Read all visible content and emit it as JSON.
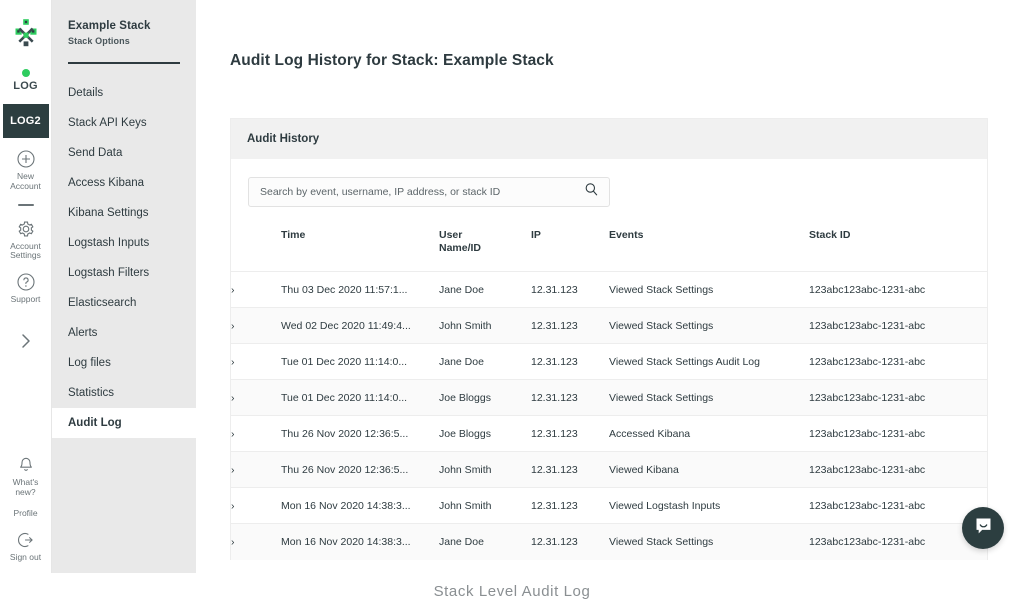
{
  "brand": {
    "logo_icon": "logit-nodes-logo",
    "green": "#2ecc5f",
    "dark": "#2c3e40"
  },
  "icon_rail": {
    "stacks": [
      {
        "label": "LOG",
        "status_dot": true,
        "active": false,
        "icon": "stack-status-dot-icon"
      },
      {
        "label": "LOG2",
        "status_dot": false,
        "active": true,
        "icon": "stack-tile-icon"
      }
    ],
    "items": [
      {
        "label": "New\nAccount",
        "line1": "New",
        "line2": "Account",
        "icon": "plus-circle-icon"
      },
      {
        "label": "Account\nSettings",
        "line1": "Account",
        "line2": "Settings",
        "icon": "gear-icon"
      },
      {
        "label": "Support",
        "line1": "Support",
        "line2": "",
        "icon": "question-circle-icon"
      }
    ],
    "expand": {
      "icon": "chevron-right-icon",
      "label": ""
    },
    "bottom_items": [
      {
        "label": "What's\nnew?",
        "line1": "What's",
        "line2": "new?",
        "icon": "bell-icon"
      },
      {
        "label": "Profile",
        "line1": "Profile",
        "line2": "",
        "icon": "avatar-icon"
      },
      {
        "label": "Sign out",
        "line1": "Sign out",
        "line2": "",
        "icon": "sign-out-icon"
      }
    ]
  },
  "options_panel": {
    "title": "Example Stack",
    "subtitle": "Stack Options",
    "nav": [
      {
        "label": "Details",
        "active": false
      },
      {
        "label": "Stack API Keys",
        "active": false
      },
      {
        "label": "Send Data",
        "active": false
      },
      {
        "label": "Access Kibana",
        "active": false
      },
      {
        "label": "Kibana Settings",
        "active": false
      },
      {
        "label": "Logstash Inputs",
        "active": false
      },
      {
        "label": "Logstash Filters",
        "active": false
      },
      {
        "label": "Elasticsearch",
        "active": false
      },
      {
        "label": "Alerts",
        "active": false
      },
      {
        "label": "Log files",
        "active": false
      },
      {
        "label": "Statistics",
        "active": false
      },
      {
        "label": "Audit Log",
        "active": true
      }
    ]
  },
  "page": {
    "title": "Audit Log History for Stack: Example Stack",
    "card_title": "Audit History"
  },
  "search": {
    "placeholder": "Search by event, username, IP address, or stack ID",
    "value": "",
    "icon": "search-icon"
  },
  "table": {
    "columns": [
      "Time",
      "User Name/ID",
      "IP",
      "Events",
      "Stack ID"
    ],
    "column_headers": {
      "toggle": "",
      "time": "Time",
      "user_line1": "User",
      "user_line2": "Name/ID",
      "ip": "IP",
      "events": "Events",
      "stack_id": "Stack ID"
    },
    "row_toggle_icon": "chevron-right-icon",
    "rows": [
      {
        "time": "Thu 03 Dec 2020 11:57:1...",
        "user": "Jane Doe",
        "ip": "12.31.123",
        "event": "Viewed Stack Settings",
        "stack_id": "123abc123abc-1231-abc"
      },
      {
        "time": "Wed 02 Dec 2020 11:49:4...",
        "user": "John Smith",
        "ip": "12.31.123",
        "event": "Viewed Stack Settings",
        "stack_id": "123abc123abc-1231-abc"
      },
      {
        "time": "Tue 01 Dec 2020 11:14:0...",
        "user": "Jane Doe",
        "ip": "12.31.123",
        "event": "Viewed Stack Settings Audit Log",
        "stack_id": "123abc123abc-1231-abc"
      },
      {
        "time": "Tue 01 Dec 2020 11:14:0...",
        "user": "Joe Bloggs",
        "ip": "12.31.123",
        "event": "Viewed Stack Settings",
        "stack_id": "123abc123abc-1231-abc"
      },
      {
        "time": "Thu 26 Nov 2020 12:36:5...",
        "user": "Joe Bloggs",
        "ip": "12.31.123",
        "event": "Accessed Kibana",
        "stack_id": "123abc123abc-1231-abc"
      },
      {
        "time": "Thu 26 Nov 2020 12:36:5...",
        "user": "John Smith",
        "ip": "12.31.123",
        "event": "Viewed Kibana",
        "stack_id": "123abc123abc-1231-abc"
      },
      {
        "time": "Mon 16 Nov 2020 14:38:3...",
        "user": "John Smith",
        "ip": "12.31.123",
        "event": "Viewed Logstash Inputs",
        "stack_id": "123abc123abc-1231-abc"
      },
      {
        "time": "Mon 16 Nov 2020 14:38:3...",
        "user": "Jane Doe",
        "ip": "12.31.123",
        "event": "Viewed Stack Settings",
        "stack_id": "123abc123abc-1231-abc"
      }
    ]
  },
  "chat_widget": {
    "icon": "chat-bubble-smile-icon",
    "label": ""
  },
  "caption": {
    "text": "Stack Level Audit Log"
  }
}
